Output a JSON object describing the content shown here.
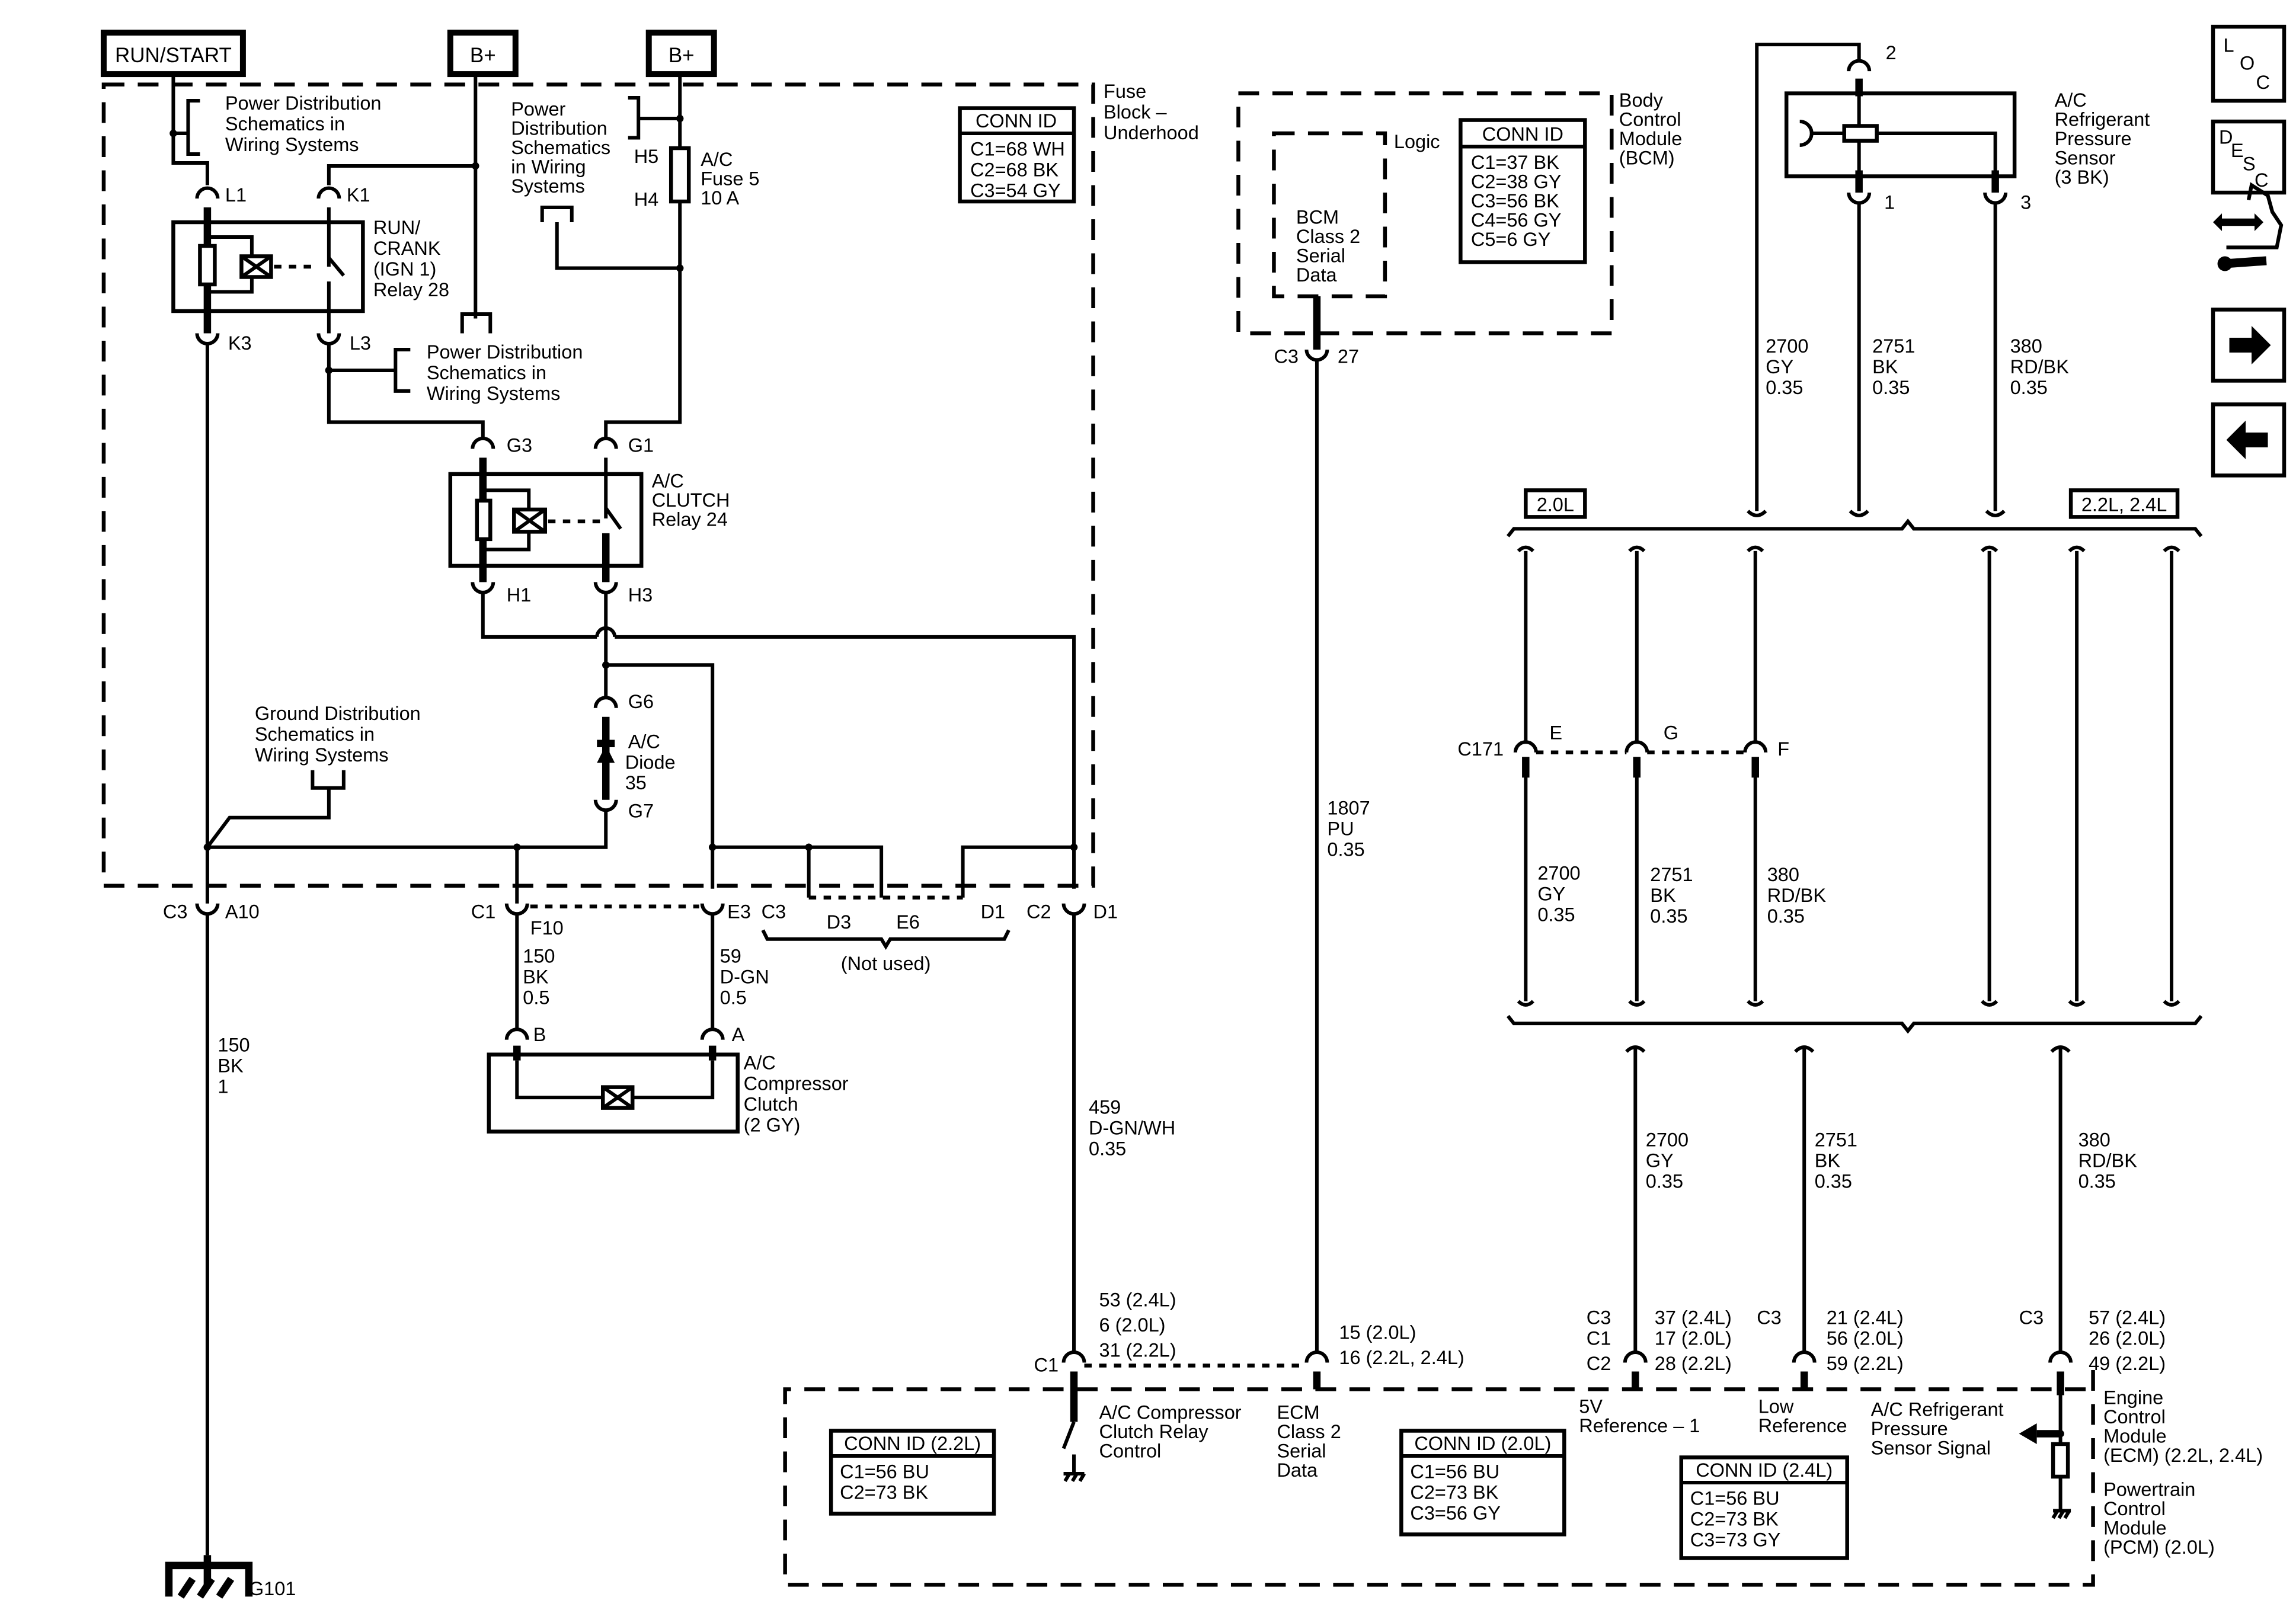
{
  "power_sources": {
    "run_start": "RUN/START",
    "b_plus_1": "B+",
    "b_plus_2": "B+"
  },
  "fuse_block": {
    "title": [
      "Fuse",
      "Block –",
      "Underhood"
    ],
    "conn_id": {
      "header": "CONN ID",
      "rows": [
        "C1=68 WH",
        "C2=68 BK",
        "C3=54 GY"
      ]
    },
    "power_dist_1": [
      "Power Distribution",
      "Schematics in",
      "Wiring Systems"
    ],
    "power_dist_2": [
      "Power",
      "Distribution",
      "Schematics",
      "in Wiring",
      "Systems"
    ],
    "power_dist_3": [
      "Power Distribution",
      "Schematics in",
      "Wiring Systems"
    ],
    "ground_dist": [
      "Ground Distribution",
      "Schematics in",
      "Wiring Systems"
    ],
    "fuse": {
      "label": [
        "A/C",
        "Fuse 5",
        "10 A"
      ],
      "pin_top": "H5",
      "pin_bottom": "H4"
    },
    "relay_28": {
      "label": [
        "RUN/",
        "CRANK",
        "(IGN 1)",
        "Relay 28"
      ],
      "pins": {
        "l1": "L1",
        "k1": "K1",
        "k3": "K3",
        "l3": "L3"
      }
    },
    "relay_24": {
      "label": [
        "A/C",
        "CLUTCH",
        "Relay 24"
      ],
      "pins": {
        "g3": "G3",
        "g1": "G1",
        "h1": "H1",
        "h3": "H3"
      }
    },
    "diode": {
      "label": [
        "A/C",
        "Diode",
        "35"
      ],
      "pin_top": "G6",
      "pin_bottom": "G7"
    },
    "connectors": {
      "c3_a10": {
        "conn": "C3",
        "pin": "A10"
      },
      "c1_f10": {
        "conn": "C1",
        "pin": "F10"
      },
      "e3": "E3",
      "c3_not_used": {
        "conn": "C3",
        "pins": [
          "D3",
          "E6",
          "D1"
        ],
        "note": "(Not used)"
      },
      "c2_d1": {
        "conn": "C2",
        "pin": "D1"
      }
    }
  },
  "wires": {
    "w150_ground": [
      "150",
      "BK",
      "1"
    ],
    "w150_clutch": [
      "150",
      "BK",
      "0.5"
    ],
    "w59": [
      "59",
      "D-GN",
      "0.5"
    ],
    "w459": [
      "459",
      "D-GN/WH",
      "0.35"
    ],
    "w1807": [
      "1807",
      "PU",
      "0.35"
    ],
    "w2700_top": [
      "2700",
      "GY",
      "0.35"
    ],
    "w2751_top": [
      "2751",
      "BK",
      "0.35"
    ],
    "w380_top": [
      "380",
      "RD/BK",
      "0.35"
    ],
    "w2700_mid": [
      "2700",
      "GY",
      "0.35"
    ],
    "w2751_mid": [
      "2751",
      "BK",
      "0.35"
    ],
    "w380_mid": [
      "380",
      "RD/BK",
      "0.35"
    ],
    "w2700_bot": [
      "2700",
      "GY",
      "0.35"
    ],
    "w2751_bot": [
      "2751",
      "BK",
      "0.35"
    ],
    "w380_bot": [
      "380",
      "RD/BK",
      "0.35"
    ]
  },
  "compressor_clutch": {
    "label": [
      "A/C",
      "Compressor",
      "Clutch",
      "(2 GY)"
    ],
    "pin_b": "B",
    "pin_a": "A"
  },
  "ground": {
    "label": "G101"
  },
  "bcm": {
    "title": [
      "Body",
      "Control",
      "Module",
      "(BCM)"
    ],
    "logic": "Logic",
    "inner": [
      "BCM",
      "Class 2",
      "Serial",
      "Data"
    ],
    "conn_id": {
      "header": "CONN ID",
      "rows": [
        "C1=37 BK",
        "C2=38 GY",
        "C3=56 BK",
        "C4=56 GY",
        "C5=6 GY"
      ]
    },
    "connector": {
      "conn": "C3",
      "pin": "27"
    }
  },
  "pressure_sensor": {
    "label": [
      "A/C",
      "Refrigerant",
      "Pressure",
      "Sensor",
      "(3 BK)"
    ],
    "pins": {
      "p2": "2",
      "p1": "1",
      "p3": "3"
    }
  },
  "engine_options": {
    "left_badge": "2.0L",
    "right_badge": "2.2L, 2.4L",
    "c171": {
      "conn": "C171",
      "pins": [
        "E",
        "G",
        "F"
      ]
    }
  },
  "ecm": {
    "title_ecm": [
      "Engine",
      "Control",
      "Module",
      "(ECM) (2.2L, 2.4L)"
    ],
    "title_pcm": [
      "Powertrain",
      "Control",
      "Module",
      "(PCM) (2.0L)"
    ],
    "relay_ctrl": {
      "conn": "C1",
      "pins": [
        "53 (2.4L)",
        "6 (2.0L)",
        "31 (2.2L)"
      ],
      "label": [
        "A/C Compressor",
        "Clutch Relay",
        "Control"
      ]
    },
    "serial": {
      "pins": [
        "15 (2.0L)",
        "16 (2.2L, 2.4L)"
      ],
      "label": [
        "ECM",
        "Class 2",
        "Serial",
        "Data"
      ]
    },
    "ref5v": {
      "conns": [
        "C3",
        "C1",
        "C2"
      ],
      "pins": [
        "37 (2.4L)",
        "17 (2.0L)",
        "28 (2.2L)"
      ],
      "label": [
        "5V",
        "Reference – 1"
      ]
    },
    "lowref": {
      "conn": "C3",
      "pins": [
        "21 (2.4L)",
        "56 (2.0L)",
        "59 (2.2L)"
      ],
      "label": [
        "Low",
        "Reference"
      ]
    },
    "signal": {
      "conn": "C3",
      "pins": [
        "57 (2.4L)",
        "26 (2.0L)",
        "49 (2.2L)"
      ],
      "label": [
        "A/C Refrigerant",
        "Pressure",
        "Sensor Signal"
      ]
    },
    "conn_22": {
      "header": "CONN ID (2.2L)",
      "rows": [
        "C1=56 BU",
        "C2=73 BK"
      ]
    },
    "conn_20": {
      "header": "CONN ID (2.0L)",
      "rows": [
        "C1=56 BU",
        "C2=73 BK",
        "C3=56 GY"
      ]
    },
    "conn_24": {
      "header": "CONN ID (2.4L)",
      "rows": [
        "C1=56 BU",
        "C2=73 BK",
        "C3=73 GY"
      ]
    }
  },
  "nav": {
    "loc": [
      "L",
      "O",
      "C"
    ],
    "desc": [
      "D",
      "E",
      "S",
      "C"
    ],
    "icons": [
      "connector-end-view-icon",
      "next-page-arrow-icon",
      "previous-page-arrow-icon"
    ]
  }
}
